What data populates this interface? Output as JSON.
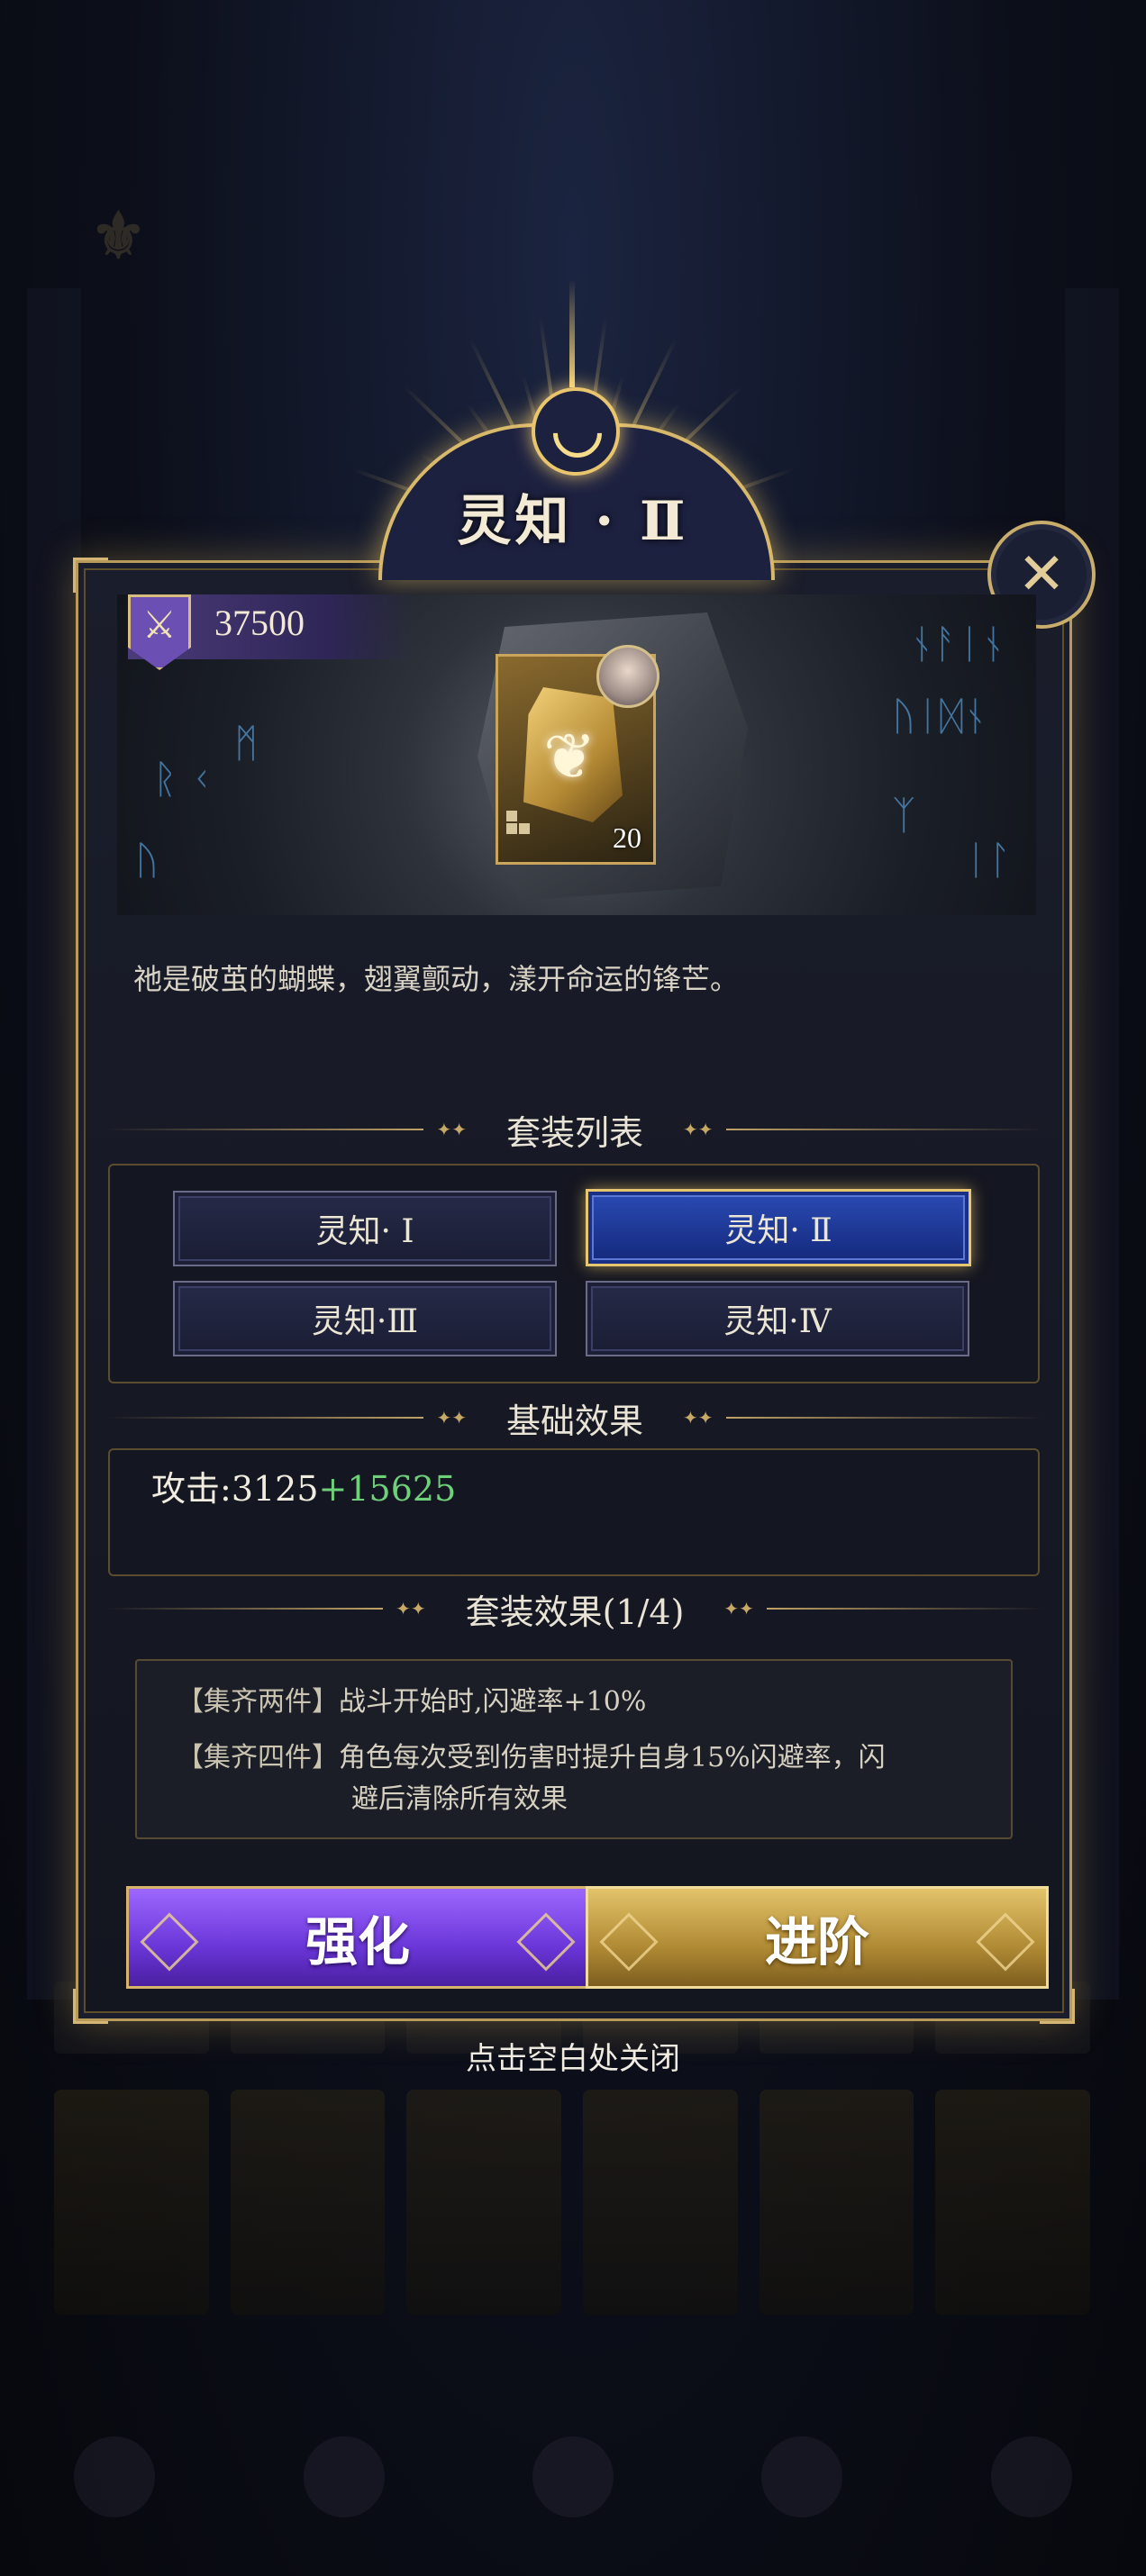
{
  "title": "灵知 · Ⅱ",
  "power": {
    "value": "37500",
    "icon": "crossed-swords-icon"
  },
  "item": {
    "count": "20",
    "icon": "butterfly-icon"
  },
  "description": "祂是破茧的蝴蝶，翅翼颤动，漾开命运的锋芒。",
  "set_list": {
    "title": "套装列表",
    "items": [
      {
        "label": "灵知· Ⅰ",
        "active": false
      },
      {
        "label": "灵知· Ⅱ",
        "active": true
      },
      {
        "label": "灵知·Ⅲ",
        "active": false
      },
      {
        "label": "灵知·Ⅳ",
        "active": false
      }
    ]
  },
  "base_effect": {
    "title": "基础效果",
    "label": "攻击:",
    "base": "3125",
    "bonus": "+15625"
  },
  "set_effect": {
    "title": "套装效果(1/4)",
    "lines": [
      {
        "key": "【集齐两件】",
        "text": "战斗开始时,闪避率+10%"
      },
      {
        "key": "【集齐四件】",
        "text": "角色每次受到伤害时提升自身15%闪避率，闪"
      },
      {
        "key": "",
        "text": "避后清除所有效果"
      }
    ]
  },
  "buttons": {
    "enhance": "强化",
    "advance": "进阶"
  },
  "hint": "点击空白处关闭",
  "colors": {
    "accent_gold": "#d8b86b",
    "enhance_purple": "#7a44e6",
    "advance_gold": "#c9a24a",
    "bonus_green": "#6fd07a"
  }
}
